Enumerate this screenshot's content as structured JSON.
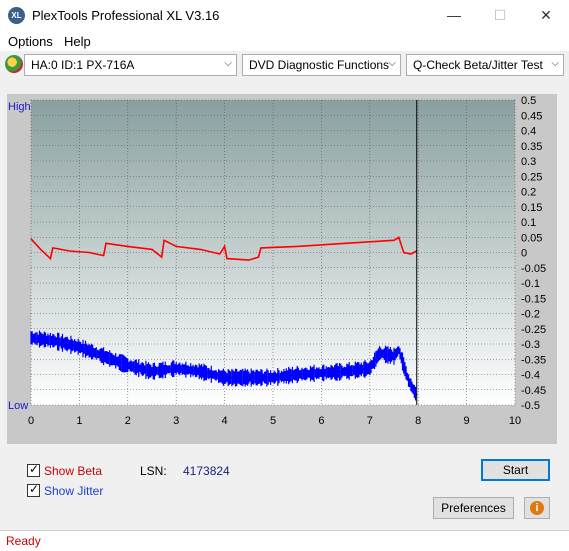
{
  "window": {
    "title": "PlexTools Professional XL V3.16",
    "icon_label": "XL"
  },
  "menu": {
    "items": [
      "Options",
      "Help"
    ]
  },
  "toolbar": {
    "drive": "HA:0 ID:1  PX-716A",
    "function": "DVD Diagnostic Functions",
    "test": "Q-Check Beta/Jitter Test"
  },
  "chart_data": {
    "type": "line",
    "left_axis": {
      "top_label": "High",
      "bottom_label": "Low"
    },
    "x": {
      "ticks": [
        "0",
        "1",
        "2",
        "3",
        "4",
        "5",
        "6",
        "7",
        "8",
        "9",
        "10"
      ],
      "range": [
        0,
        10
      ]
    },
    "y": {
      "ticks": [
        "0.5",
        "0.45",
        "0.4",
        "0.35",
        "0.3",
        "0.25",
        "0.2",
        "0.15",
        "0.1",
        "0.05",
        "0",
        "-0.05",
        "-0.1",
        "-0.15",
        "-0.2",
        "-0.25",
        "-0.3",
        "-0.35",
        "-0.4",
        "-0.45",
        "-0.5"
      ],
      "range": [
        -0.5,
        0.5
      ]
    },
    "cursor_x": 7.97,
    "colors": {
      "beta": "#ff0000",
      "jitter": "#0000ff",
      "background": "#9fb3b3"
    },
    "series": [
      {
        "name": "Beta",
        "color": "#ff0000",
        "points": [
          [
            0,
            0.045
          ],
          [
            0.2,
            0.01
          ],
          [
            0.4,
            -0.02
          ],
          [
            0.45,
            0.015
          ],
          [
            0.8,
            0.005
          ],
          [
            1.2,
            0.0
          ],
          [
            1.5,
            -0.01
          ],
          [
            1.55,
            0.03
          ],
          [
            2.0,
            0.02
          ],
          [
            2.5,
            0.01
          ],
          [
            2.7,
            -0.015
          ],
          [
            2.75,
            0.04
          ],
          [
            3.0,
            0.02
          ],
          [
            3.5,
            0.01
          ],
          [
            3.9,
            -0.005
          ],
          [
            4.0,
            0.02
          ],
          [
            4.05,
            -0.02
          ],
          [
            4.5,
            -0.025
          ],
          [
            4.7,
            -0.015
          ],
          [
            4.75,
            0.015
          ],
          [
            5.5,
            0.02
          ],
          [
            6.5,
            0.03
          ],
          [
            7.5,
            0.04
          ],
          [
            7.6,
            0.05
          ],
          [
            7.7,
            0.0
          ],
          [
            7.85,
            -0.005
          ],
          [
            7.97,
            0.005
          ]
        ]
      },
      {
        "name": "Jitter",
        "color": "#0000ff",
        "points": [
          [
            0,
            -0.28
          ],
          [
            0.5,
            -0.29
          ],
          [
            1.0,
            -0.31
          ],
          [
            1.5,
            -0.34
          ],
          [
            2.0,
            -0.37
          ],
          [
            2.5,
            -0.39
          ],
          [
            3.0,
            -0.38
          ],
          [
            3.5,
            -0.39
          ],
          [
            4.0,
            -0.41
          ],
          [
            4.5,
            -0.41
          ],
          [
            5.0,
            -0.41
          ],
          [
            5.5,
            -0.4
          ],
          [
            6.0,
            -0.395
          ],
          [
            6.5,
            -0.39
          ],
          [
            7.0,
            -0.38
          ],
          [
            7.2,
            -0.33
          ],
          [
            7.5,
            -0.34
          ],
          [
            7.6,
            -0.32
          ],
          [
            7.8,
            -0.42
          ],
          [
            7.97,
            -0.47
          ]
        ]
      }
    ]
  },
  "panel": {
    "show_beta": {
      "label": "Show Beta",
      "checked": true,
      "color": "#cc0000"
    },
    "show_jitter": {
      "label": "Show Jitter",
      "checked": true,
      "color": "#1a3fcf"
    },
    "lsn_label": "LSN:",
    "lsn_value": "4173824",
    "start_label": "Start",
    "preferences_label": "Preferences",
    "info_icon": "info-icon"
  },
  "status": {
    "text": "Ready",
    "color": "#cc0000"
  }
}
